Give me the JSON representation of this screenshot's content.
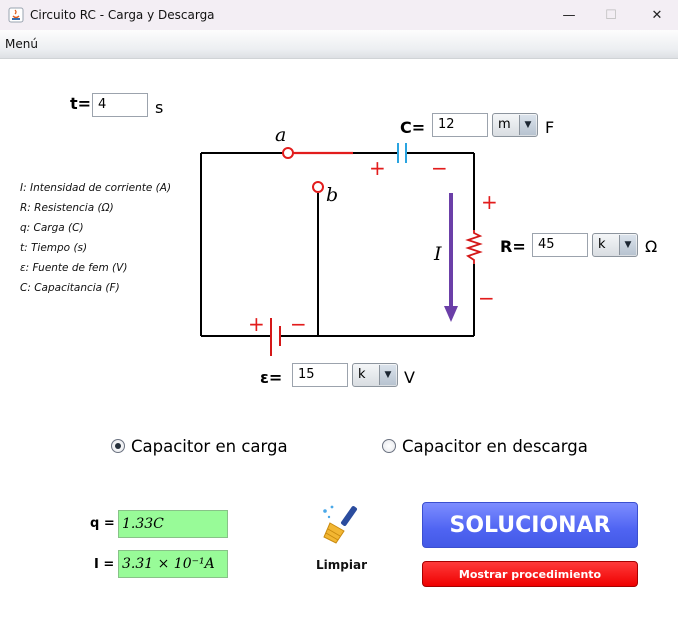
{
  "window": {
    "title": "Circuito RC - Carga y Descarga",
    "menu": "Menú",
    "minimize": "—",
    "maximize": "☐",
    "close": "✕"
  },
  "time": {
    "label": "t=",
    "value": "4",
    "unit": "s"
  },
  "capacitor": {
    "label": "C=",
    "value": "12",
    "prefix": "m",
    "unit": "F"
  },
  "resistor": {
    "label": "R=",
    "value": "45",
    "prefix": "k",
    "unit": "Ω"
  },
  "source": {
    "label": "ε=",
    "value": "15",
    "prefix": "k",
    "unit": "V"
  },
  "circuit": {
    "a": "a",
    "b": "b",
    "current": "I",
    "plus": "+",
    "minus": "−"
  },
  "legend": [
    "I: Intensidad de corriente (A)",
    "R: Resistencia (Ω)",
    "q: Carga (C)",
    "t: Tiempo (s)",
    "ε: Fuente de fem (V)",
    "C: Capacitancia (F)"
  ],
  "mode": {
    "charging": "Capacitor en carga",
    "discharging": "Capacitor en descarga",
    "selected": "charging"
  },
  "results": {
    "q_label": "q =",
    "q_value": "1.33C",
    "i_label": "I =",
    "i_value": "3.31 × 10⁻¹A"
  },
  "buttons": {
    "clear": "Limpiar",
    "solve": "SOLUCIONAR",
    "procedure": "Mostrar procedimiento"
  },
  "colors": {
    "wire": "#000000",
    "switch": "#e21c1c",
    "capacitor": "#2aa4e0",
    "arrow": "#6b3fa8",
    "solve": "#4f64f2",
    "procedure": "#ef0000",
    "result": "#98fb98"
  }
}
